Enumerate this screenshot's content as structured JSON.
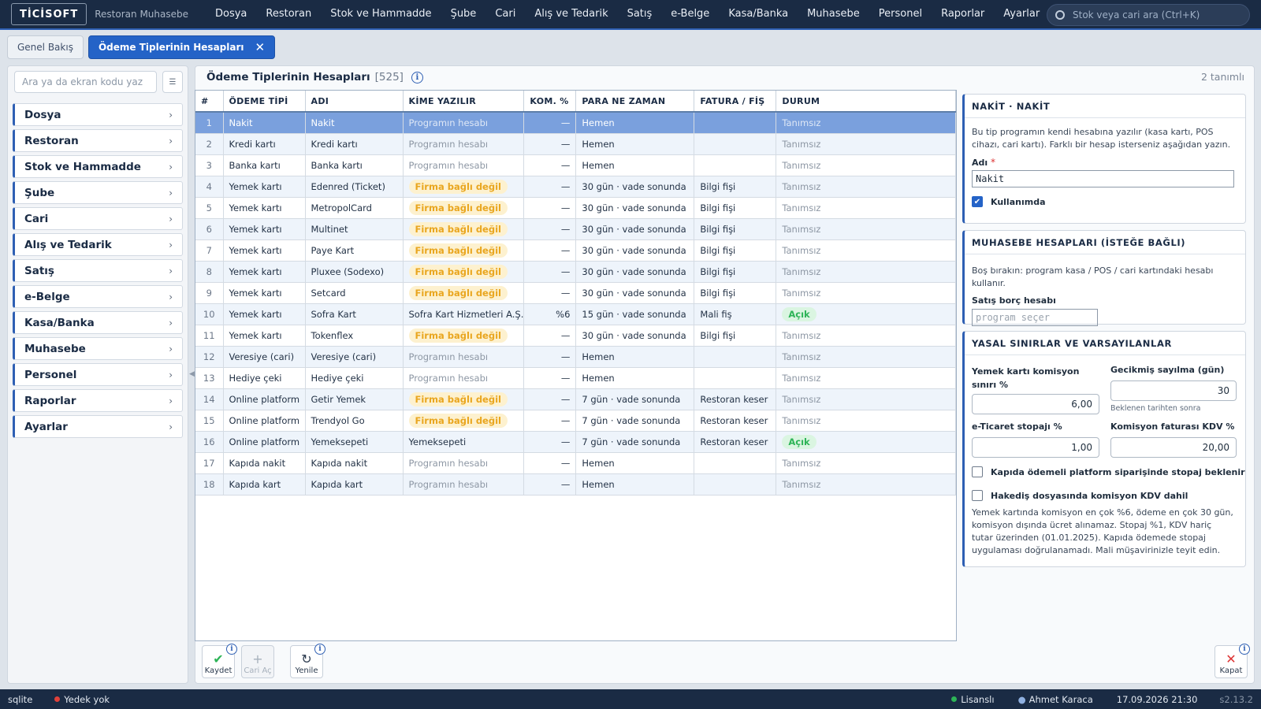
{
  "app": {
    "brand": "TİCİSOFT",
    "subtitle": "Restoran Muhasebe"
  },
  "menu": [
    "Dosya",
    "Restoran",
    "Stok ve Hammadde",
    "Şube",
    "Cari",
    "Alış ve Tedarik",
    "Satış",
    "e-Belge",
    "Kasa/Banka",
    "Muhasebe",
    "Personel",
    "Raporlar",
    "Ayarlar"
  ],
  "search": {
    "placeholder": "Stok veya cari ara (Ctrl+K)"
  },
  "tabs": {
    "overview": "Genel Bakış",
    "active": "Ödeme Tiplerinin Hesapları",
    "close": "✕"
  },
  "sidebar": {
    "search_placeholder": "Ara ya da ekran kodu yaz",
    "items": [
      "Dosya",
      "Restoran",
      "Stok ve Hammadde",
      "Şube",
      "Cari",
      "Alış ve Tedarik",
      "Satış",
      "e-Belge",
      "Kasa/Banka",
      "Muhasebe",
      "Personel",
      "Raporlar",
      "Ayarlar"
    ]
  },
  "main": {
    "title": "Ödeme Tiplerinin Hesapları",
    "code": "[525]",
    "defined_count": "2 tanımlı"
  },
  "table": {
    "headers": [
      "#",
      "ÖDEME TİPİ",
      "ADI",
      "KİME YAZILIR",
      "KOM. %",
      "PARA NE ZAMAN",
      "FATURA / FİŞ",
      "DURUM"
    ],
    "rows": [
      {
        "n": "1",
        "type": "Nakit",
        "name": "Nakit",
        "to": "Programın hesabı",
        "to_kind": "muted",
        "kom": "—",
        "when": "Hemen",
        "invoice": "",
        "status": "Tanımsız",
        "status_kind": "muted"
      },
      {
        "n": "2",
        "type": "Kredi kartı",
        "name": "Kredi kartı",
        "to": "Programın hesabı",
        "to_kind": "muted",
        "kom": "—",
        "when": "Hemen",
        "invoice": "",
        "status": "Tanımsız",
        "status_kind": "muted"
      },
      {
        "n": "3",
        "type": "Banka kartı",
        "name": "Banka kartı",
        "to": "Programın hesabı",
        "to_kind": "muted",
        "kom": "—",
        "when": "Hemen",
        "invoice": "",
        "status": "Tanımsız",
        "status_kind": "muted"
      },
      {
        "n": "4",
        "type": "Yemek kartı",
        "name": "Edenred (Ticket)",
        "to": "Firma bağlı değil",
        "to_kind": "warn",
        "kom": "—",
        "when": "30 gün · vade sonunda",
        "invoice": "Bilgi fişi",
        "status": "Tanımsız",
        "status_kind": "muted"
      },
      {
        "n": "5",
        "type": "Yemek kartı",
        "name": "MetropolCard",
        "to": "Firma bağlı değil",
        "to_kind": "warn",
        "kom": "—",
        "when": "30 gün · vade sonunda",
        "invoice": "Bilgi fişi",
        "status": "Tanımsız",
        "status_kind": "muted"
      },
      {
        "n": "6",
        "type": "Yemek kartı",
        "name": "Multinet",
        "to": "Firma bağlı değil",
        "to_kind": "warn",
        "kom": "—",
        "when": "30 gün · vade sonunda",
        "invoice": "Bilgi fişi",
        "status": "Tanımsız",
        "status_kind": "muted"
      },
      {
        "n": "7",
        "type": "Yemek kartı",
        "name": "Paye Kart",
        "to": "Firma bağlı değil",
        "to_kind": "warn",
        "kom": "—",
        "when": "30 gün · vade sonunda",
        "invoice": "Bilgi fişi",
        "status": "Tanımsız",
        "status_kind": "muted"
      },
      {
        "n": "8",
        "type": "Yemek kartı",
        "name": "Pluxee (Sodexo)",
        "to": "Firma bağlı değil",
        "to_kind": "warn",
        "kom": "—",
        "when": "30 gün · vade sonunda",
        "invoice": "Bilgi fişi",
        "status": "Tanımsız",
        "status_kind": "muted"
      },
      {
        "n": "9",
        "type": "Yemek kartı",
        "name": "Setcard",
        "to": "Firma bağlı değil",
        "to_kind": "warn",
        "kom": "—",
        "when": "30 gün · vade sonunda",
        "invoice": "Bilgi fişi",
        "status": "Tanımsız",
        "status_kind": "muted"
      },
      {
        "n": "10",
        "type": "Yemek kartı",
        "name": "Sofra Kart",
        "to": "Sofra Kart Hizmetleri A.Ş.",
        "to_kind": "plain",
        "kom": "%6",
        "when": "15 gün · vade sonunda",
        "invoice": "Mali fiş",
        "status": "Açık",
        "status_kind": "ok"
      },
      {
        "n": "11",
        "type": "Yemek kartı",
        "name": "Tokenflex",
        "to": "Firma bağlı değil",
        "to_kind": "warn",
        "kom": "—",
        "when": "30 gün · vade sonunda",
        "invoice": "Bilgi fişi",
        "status": "Tanımsız",
        "status_kind": "muted"
      },
      {
        "n": "12",
        "type": "Veresiye (cari)",
        "name": "Veresiye (cari)",
        "to": "Programın hesabı",
        "to_kind": "muted",
        "kom": "—",
        "when": "Hemen",
        "invoice": "",
        "status": "Tanımsız",
        "status_kind": "muted"
      },
      {
        "n": "13",
        "type": "Hediye çeki",
        "name": "Hediye çeki",
        "to": "Programın hesabı",
        "to_kind": "muted",
        "kom": "—",
        "when": "Hemen",
        "invoice": "",
        "status": "Tanımsız",
        "status_kind": "muted"
      },
      {
        "n": "14",
        "type": "Online platform",
        "name": "Getir Yemek",
        "to": "Firma bağlı değil",
        "to_kind": "warn",
        "kom": "—",
        "when": "7 gün · vade sonunda",
        "invoice": "Restoran keser",
        "status": "Tanımsız",
        "status_kind": "muted"
      },
      {
        "n": "15",
        "type": "Online platform",
        "name": "Trendyol Go",
        "to": "Firma bağlı değil",
        "to_kind": "warn",
        "kom": "—",
        "when": "7 gün · vade sonunda",
        "invoice": "Restoran keser",
        "status": "Tanımsız",
        "status_kind": "muted"
      },
      {
        "n": "16",
        "type": "Online platform",
        "name": "Yemeksepeti",
        "to": "Yemeksepeti",
        "to_kind": "plain",
        "kom": "—",
        "when": "7 gün · vade sonunda",
        "invoice": "Restoran keser",
        "status": "Açık",
        "status_kind": "ok"
      },
      {
        "n": "17",
        "type": "Kapıda nakit",
        "name": "Kapıda nakit",
        "to": "Programın hesabı",
        "to_kind": "muted",
        "kom": "—",
        "when": "Hemen",
        "invoice": "",
        "status": "Tanımsız",
        "status_kind": "muted"
      },
      {
        "n": "18",
        "type": "Kapıda kart",
        "name": "Kapıda kart",
        "to": "Programın hesabı",
        "to_kind": "muted",
        "kom": "—",
        "when": "Hemen",
        "invoice": "",
        "status": "Tanımsız",
        "status_kind": "muted"
      }
    ]
  },
  "detail": {
    "title": "NAKİT · NAKİT",
    "desc": "Bu tip programın kendi hesabına yazılır (kasa kartı, POS cihazı, cari kartı). Farklı bir hesap isterseniz aşağıdan yazın.",
    "name_label": "Adı",
    "required_mark": "*",
    "name_value": "Nakit",
    "in_use_label": "Kullanımda"
  },
  "accounts": {
    "title": "MUHASEBE HESAPLARI (İSTEĞE BAĞLI)",
    "desc": "Boş bırakın: program kasa / POS / cari kartındaki hesabı kullanır.",
    "label": "Satış borç hesabı",
    "placeholder": "program seçer"
  },
  "legal": {
    "title": "YASAL SINIRLAR VE VARSAYILANLAR",
    "commission_label": "Yemek kartı komisyon sınırı %",
    "commission_value": "6,00",
    "overdue_label": "Gecikmiş sayılma (gün)",
    "overdue_value": "30",
    "overdue_hint": "Beklenen tarihten sonra",
    "withholding_label": "e-Ticaret stopajı %",
    "withholding_value": "1,00",
    "kdv_label": "Komisyon faturası KDV %",
    "kdv_value": "20,00",
    "check1": "Kapıda ödemeli platform siparişinde stopaj beklenir",
    "check2": "Hakediş dosyasında komisyon KDV dahil",
    "note": "Yemek kartında komisyon en çok %6, ödeme en çok 30 gün, komisyon dışında ücret alınamaz. Stopaj %1, KDV hariç tutar üzerinden (01.01.2025). Kapıda ödemede stopaj uygulaması doğrulanamadı. Mali müşavirinizle teyit edin."
  },
  "footer": {
    "save": "Kaydet",
    "open_account": "Cari Aç",
    "refresh": "Yenile",
    "close": "Kapat",
    "info": "i"
  },
  "status": {
    "db": "sqlite",
    "backup": "Yedek yok",
    "license": "Lisanslı",
    "user": "Ahmet Karaca",
    "datetime": "17.09.2026 21:30",
    "version": "s2.13.2"
  },
  "colors": {
    "accent": "#2463c7",
    "navy": "#1a2b44",
    "warn": "#e9a61f",
    "ok": "#2db457",
    "backup_dot": "#e0413a",
    "license_dot": "#2db457"
  }
}
